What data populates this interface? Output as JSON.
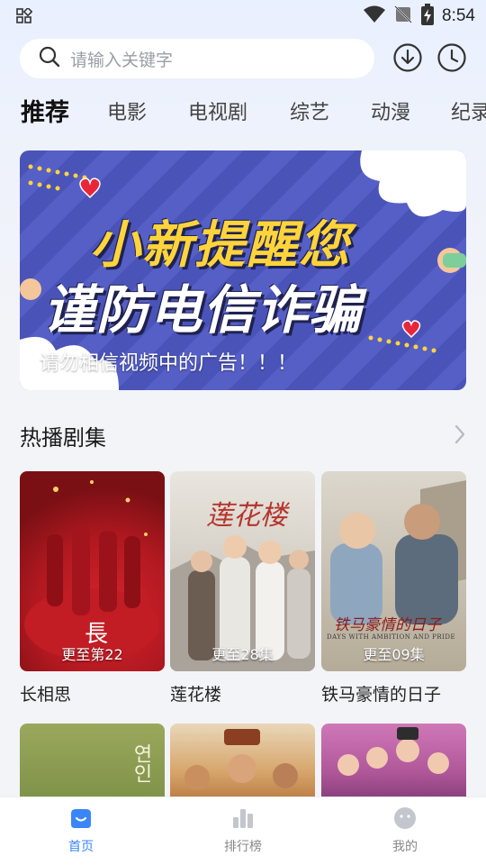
{
  "status_bar": {
    "time": "8:54"
  },
  "search": {
    "placeholder": "请输入关键字"
  },
  "tabs": [
    {
      "label": "推荐",
      "active": true
    },
    {
      "label": "电影"
    },
    {
      "label": "电视剧"
    },
    {
      "label": "综艺"
    },
    {
      "label": "动漫"
    },
    {
      "label": "纪录"
    }
  ],
  "banner": {
    "line1": "小新提醒您",
    "line2": "谨防电信诈骗",
    "caption": "请勿相信视频中的广告！！！"
  },
  "section": {
    "title": "热播剧集"
  },
  "cards": [
    {
      "title": "长相思",
      "episode": "更至第22",
      "poster_text": "長"
    },
    {
      "title": "莲花楼",
      "episode": "更至28集",
      "poster_text": "莲花楼"
    },
    {
      "title": "铁马豪情的日子",
      "episode": "更至09集",
      "poster_text": "铁马豪情的日子",
      "poster_subtext": "DAYS WITH AMBITION AND PRIDE"
    }
  ],
  "row2_posters": [
    {
      "poster_text": "연인"
    },
    {
      "poster_text": ""
    },
    {
      "poster_text": ""
    }
  ],
  "bottom_nav": [
    {
      "label": "首页",
      "icon": "home-icon",
      "active": true
    },
    {
      "label": "排行榜",
      "icon": "ranking-icon"
    },
    {
      "label": "我的",
      "icon": "profile-icon"
    }
  ],
  "colors": {
    "accent": "#3a86f7",
    "banner_bg": "#4a53b8",
    "banner_text": "#ffd43b"
  }
}
